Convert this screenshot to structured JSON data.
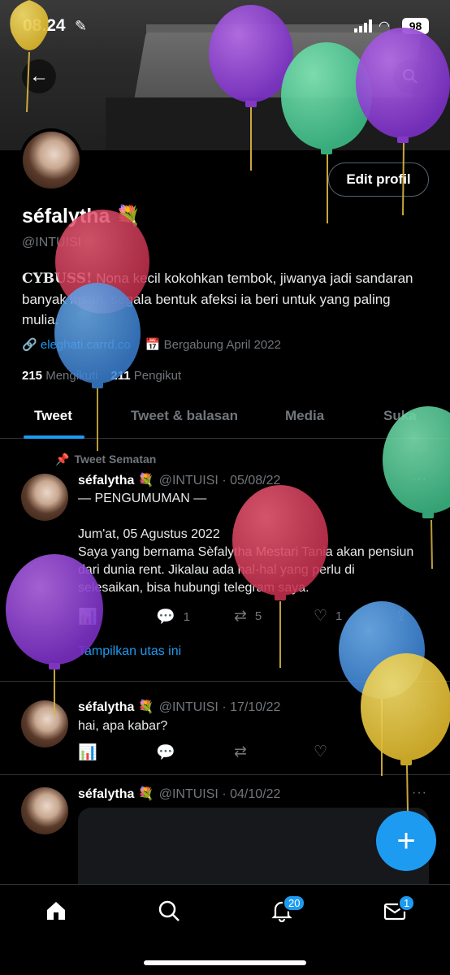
{
  "status_bar": {
    "time": "08.24",
    "battery": "98"
  },
  "profile": {
    "display_name": "séfalytha 💐",
    "handle": "@INTUISI",
    "edit_button": "Edit profil",
    "bio_bold": "CYBUSS!",
    "bio_rest": " Nona kecil kokohkan tembok, jiwanya jadi sandaran banyak insan, segala bentuk afeksi ia beri untuk yang paling mulia.",
    "link": "eleghati.carrd.co",
    "joined": "Bergabung April 2022",
    "following_count": "215",
    "following_label": "Mengikuti",
    "followers_count": "211",
    "followers_label": "Pengikut"
  },
  "tabs": [
    "Tweet",
    "Tweet & balasan",
    "Media",
    "Suka"
  ],
  "pinned_label": "Tweet Sematan",
  "tweets": [
    {
      "name": "séfalytha 💐",
      "meta": "@INTUISI · 05/08/22",
      "body": "— PENGUMUMAN —\n\nJum'at, 05 Agustus 2022\nSaya yang bernama Sèfalytha Mestari Tania akan pensiun dari dunia rent. Jikalau ada hal-hal yang perlu di selesaikan, bisa hubungi telegram saya.",
      "replies": "1",
      "retweets": "5",
      "likes": "1",
      "show_thread": "Tampilkan utas ini"
    },
    {
      "name": "séfalytha 💐",
      "meta": "@INTUISI · 17/10/22",
      "body": "hai, apa kabar?"
    },
    {
      "name": "séfalytha 💐",
      "meta": "@INTUISI · 04/10/22"
    }
  ],
  "nav": {
    "notifications_badge": "20",
    "messages_badge": "1"
  },
  "colors": {
    "accent": "#1d9bf0",
    "background": "#000000",
    "muted": "#71767b"
  }
}
